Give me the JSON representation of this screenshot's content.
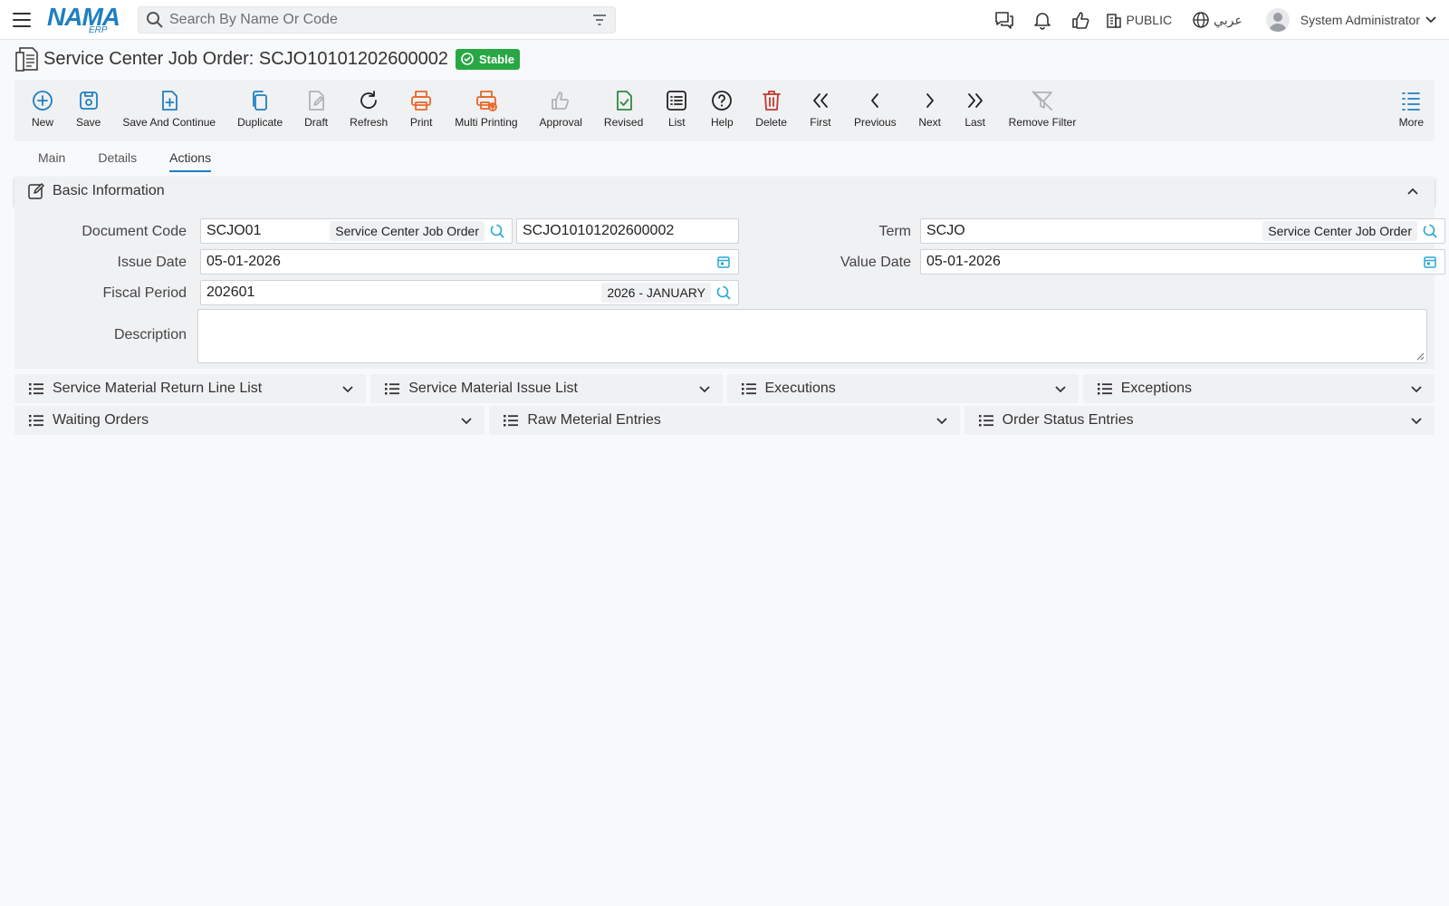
{
  "app": {
    "logo_text": "NAMA",
    "logo_sub": "ERP",
    "search_placeholder": "Search By Name Or Code",
    "branch": "PUBLIC",
    "language": "عربي",
    "user_name": "System Administrator"
  },
  "page": {
    "title": "Service Center Job Order: SCJO10101202600002",
    "status": "Stable",
    "status_color": "#28a745"
  },
  "toolbar": [
    {
      "label": "New",
      "icon": "plus-circle-icon",
      "color": "#1f7fc1"
    },
    {
      "label": "Save",
      "icon": "save-icon",
      "color": "#1f7fc1"
    },
    {
      "label": "Save And Continue",
      "icon": "file-plus-icon",
      "color": "#1f7fc1"
    },
    {
      "label": "Duplicate",
      "icon": "copy-icon",
      "color": "#1f7fc1"
    },
    {
      "label": "Draft",
      "icon": "draft-icon",
      "color": "#b0b3b8"
    },
    {
      "label": "Refresh",
      "icon": "refresh-icon",
      "color": "#222"
    },
    {
      "label": "Print",
      "icon": "printer-icon",
      "color": "#e8672a"
    },
    {
      "label": "Multi Printing",
      "icon": "multi-printer-icon",
      "color": "#e8672a"
    },
    {
      "label": "Approval",
      "icon": "thumbs-up-icon",
      "color": "#b0b3b8"
    },
    {
      "label": "Revised",
      "icon": "file-check-icon",
      "color": "#2e8b3e"
    },
    {
      "label": "List",
      "icon": "list-icon",
      "color": "#222"
    },
    {
      "label": "Help",
      "icon": "help-icon",
      "color": "#222"
    },
    {
      "label": "Delete",
      "icon": "trash-icon",
      "color": "#c0392b"
    },
    {
      "label": "First",
      "icon": "chevrons-left-icon",
      "color": "#222"
    },
    {
      "label": "Previous",
      "icon": "chevron-left-icon",
      "color": "#222"
    },
    {
      "label": "Next",
      "icon": "chevron-right-icon",
      "color": "#222"
    },
    {
      "label": "Last",
      "icon": "chevrons-right-icon",
      "color": "#222"
    },
    {
      "label": "Remove Filter",
      "icon": "filter-off-icon",
      "color": "#b0b3b8"
    }
  ],
  "toolbar_more": "More",
  "tabs": [
    "Main",
    "Details",
    "Actions"
  ],
  "active_tab": "Actions",
  "section": {
    "title": "Basic Information"
  },
  "form": {
    "document_code_label": "Document Code",
    "document_code": "SCJO01",
    "document_code_tag": "Service Center Job Order",
    "document_number": "SCJO10101202600002",
    "term_label": "Term",
    "term": "SCJO",
    "term_tag": "Service Center Job Order",
    "issue_date_label": "Issue Date",
    "issue_date": "05-01-2026",
    "value_date_label": "Value Date",
    "value_date": "05-01-2026",
    "fiscal_period_label": "Fiscal Period",
    "fiscal_period": "202601",
    "fiscal_period_tag": "2026 - JANUARY",
    "description_label": "Description",
    "description": ""
  },
  "lists_row1": [
    "Service Material Return Line List",
    "Service Material Issue List",
    "Executions",
    "Exceptions"
  ],
  "lists_row2": [
    "Waiting Orders",
    "Raw Meterial Entries",
    "Order Status Entries"
  ]
}
